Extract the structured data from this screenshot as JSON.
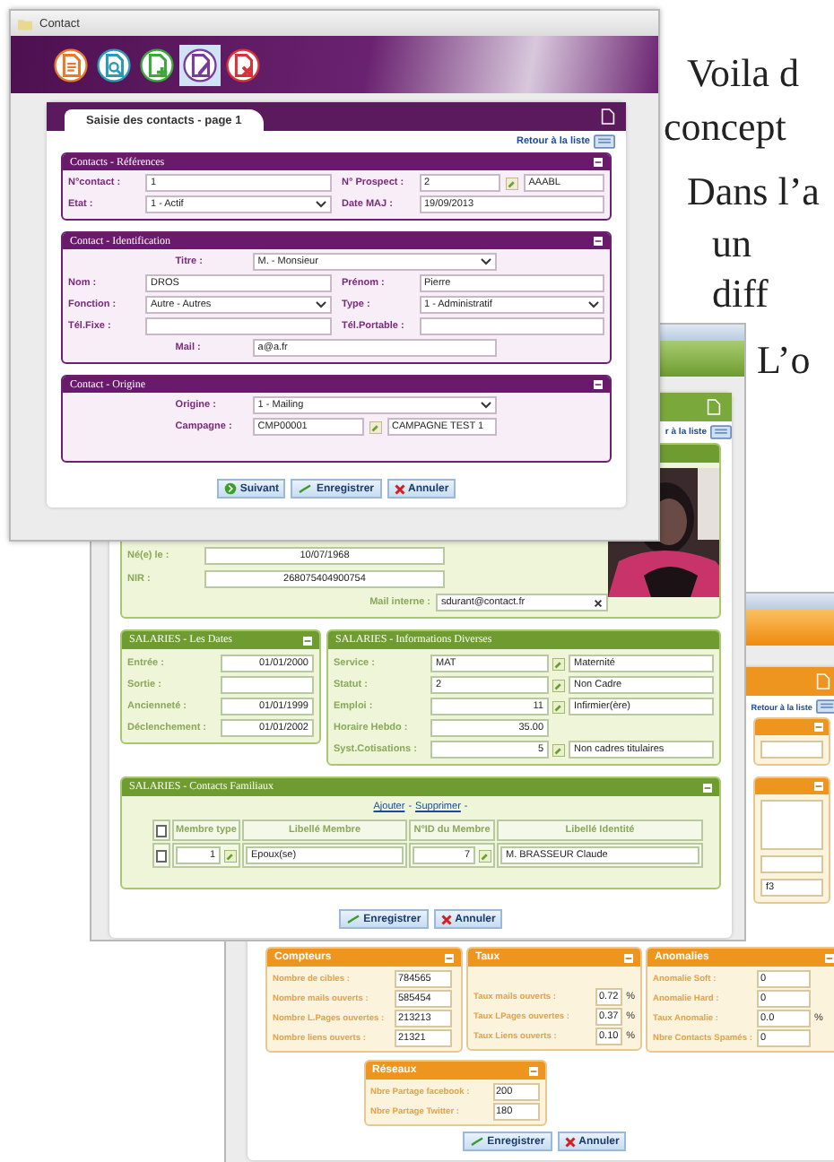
{
  "document_text": [
    {
      "kind": "first",
      "text": "Voila d"
    },
    {
      "kind": "wrap",
      "text": "concept"
    },
    {
      "kind": "first",
      "text": "Dans l’a"
    },
    {
      "kind": "list",
      "text": "un"
    },
    {
      "kind": "list",
      "text": "diff"
    },
    {
      "kind": "sub",
      "text": "L’o"
    }
  ],
  "contact_window": {
    "title": "Contact",
    "toolbar": [
      {
        "kind": "document",
        "color": "#e8782a",
        "selected": false
      },
      {
        "kind": "search",
        "color": "#2a9ab8",
        "selected": false
      },
      {
        "kind": "add",
        "color": "#3aa83a",
        "selected": false
      },
      {
        "kind": "edit",
        "color": "#7a3a9a",
        "selected": true
      },
      {
        "kind": "delete",
        "color": "#d8323a",
        "selected": false
      }
    ],
    "page_tab": "Saisie des contacts - page 1",
    "back_link": "Retour à la liste",
    "sections": [
      {
        "title": "Contacts - Références",
        "rows": [
          [
            {
              "label": "N°contact :",
              "value": "1",
              "kind": "text"
            },
            {
              "label": "N° Prospect :",
              "value": "2",
              "kind": "lookup",
              "description": "AAABL"
            }
          ],
          [
            {
              "label": "Etat :",
              "value": "1 - Actif",
              "kind": "select"
            },
            {
              "label": "Date MAJ :",
              "value": "19/09/2013",
              "kind": "text"
            }
          ]
        ]
      },
      {
        "title": "Contact - Identification",
        "rows": [
          [
            {
              "label": "Titre :",
              "value": "M. - Monsieur",
              "kind": "select"
            }
          ],
          [
            {
              "label": "Nom :",
              "value": "DROS",
              "kind": "text"
            },
            {
              "label": "Prénom :",
              "value": "Pierre",
              "kind": "text"
            }
          ],
          [
            {
              "label": "Fonction :",
              "value": "Autre - Autres",
              "kind": "select"
            },
            {
              "label": "Type :",
              "value": "1 - Administratif",
              "kind": "select"
            }
          ],
          [
            {
              "label": "Tél.Fixe :",
              "kind": "text"
            },
            {
              "label": "Tél.Portable :",
              "kind": "text"
            }
          ],
          [
            {
              "label": "Mail :",
              "value": "a@a.fr",
              "kind": "text"
            }
          ]
        ]
      },
      {
        "title": "Contact - Origine",
        "rows": [
          [
            {
              "label": "Origine :",
              "value": "1 - Mailing",
              "kind": "select"
            }
          ],
          [
            {
              "label": "Campagne :",
              "value": "CMP00001",
              "kind": "lookup",
              "description": "CAMPAGNE TEST 1"
            }
          ]
        ]
      }
    ],
    "buttons": [
      {
        "kind": "next",
        "label": "Suivant"
      },
      {
        "kind": "save",
        "label": "Enregistrer"
      },
      {
        "kind": "cancel",
        "label": "Annuler"
      }
    ]
  },
  "employee_window": {
    "back_link": "r à la liste",
    "identity_fields": [
      {
        "kind": "text",
        "label": "Né(e) le :",
        "value": "10/07/1968"
      },
      {
        "kind": "text",
        "label": "NIR :",
        "value": "268075404900754"
      },
      {
        "kind": "email",
        "label": "Mail interne :",
        "value": "sdurant@contact.fr"
      }
    ],
    "dates": {
      "title": "SALARIES - Les Dates",
      "fields": [
        {
          "label": "Entrée :",
          "value": "01/01/2000"
        },
        {
          "label": "Sortie :"
        },
        {
          "label": "Ancienneté :",
          "value": "01/01/1999"
        },
        {
          "label": "Déclenchement :",
          "value": "01/01/2002"
        }
      ]
    },
    "infos": {
      "title": "SALARIES - Informations Diverses",
      "fields": [
        {
          "kind": "code",
          "label": "Service :",
          "value": "MAT",
          "description": "Maternité"
        },
        {
          "kind": "code",
          "label": "Statut :",
          "value": "2",
          "description": "Non Cadre"
        },
        {
          "kind": "number",
          "label": "Emploi :",
          "value": "11",
          "description": "Infirmier(ère)"
        },
        {
          "kind": "number",
          "label": "Horaire Hebdo :",
          "value": "35.00"
        },
        {
          "kind": "number",
          "label": "Syst.Cotisations :",
          "value": "5",
          "description": "Non cadres titulaires"
        }
      ]
    },
    "family": {
      "title": "SALARIES - Contacts Familiaux",
      "actions": [
        "Ajouter",
        "Supprimer"
      ],
      "separator": "-",
      "select_all_checked": false,
      "columns": [
        "Membre type",
        "Libellé Membre",
        "N°ID du Membre",
        "Libellé Identité"
      ],
      "rows": [
        {
          "checked": false,
          "member_type": "1",
          "member_label": "Epoux(se)",
          "member_id": "7",
          "identity": "M. BRASSEUR Claude"
        }
      ]
    },
    "buttons": [
      {
        "kind": "save",
        "label": "Enregistrer"
      },
      {
        "kind": "cancel",
        "label": "Annuler"
      }
    ]
  },
  "campaign_window": {
    "back_link": "Retour à la liste",
    "fragment_value": "f3",
    "cards": [
      {
        "title": "Compteurs",
        "fields": [
          {
            "label": "Nombre de cibles :",
            "value": "784565"
          },
          {
            "label": "Nombre mails ouverts :",
            "value": "585454"
          },
          {
            "label": "Nombre L.Pages ouvertes :",
            "value": "213213"
          },
          {
            "label": "Nombre liens ouverts :",
            "value": "21321"
          }
        ]
      },
      {
        "title": "Taux",
        "fields": [
          {
            "label": "Taux mails ouverts :",
            "value": "0.72",
            "unit": "%"
          },
          {
            "label": "Taux LPages ouvertes :",
            "value": "0.37",
            "unit": "%"
          },
          {
            "label": "Taux Liens ouverts :",
            "value": "0.10",
            "unit": "%"
          }
        ]
      },
      {
        "title": "Anomalies",
        "fields": [
          {
            "label": "Anomalie Soft :",
            "value": "0"
          },
          {
            "label": "Anomalie Hard :",
            "value": "0"
          },
          {
            "label": "Taux Anomalie :",
            "value": "0.0",
            "unit": "%"
          },
          {
            "label": "Nbre Contacts Spamés :",
            "value": "0"
          }
        ]
      }
    ],
    "networks": {
      "title": "Réseaux",
      "fields": [
        {
          "label": "Nbre Partage facebook :",
          "value": "200"
        },
        {
          "label": "Nbre Partage Twitter :",
          "value": "180"
        }
      ]
    },
    "buttons": [
      {
        "kind": "save",
        "label": "Enregistrer"
      },
      {
        "kind": "cancel",
        "label": "Annuler"
      }
    ]
  }
}
